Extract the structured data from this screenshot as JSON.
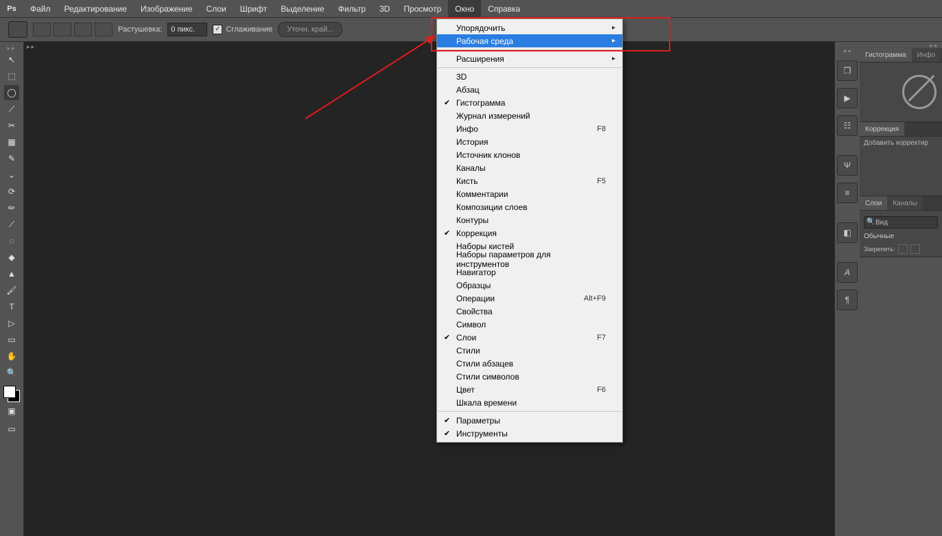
{
  "logo": "Ps",
  "menu": [
    "Файл",
    "Редактирование",
    "Изображение",
    "Слои",
    "Шрифт",
    "Выделение",
    "Фильтр",
    "3D",
    "Просмотр",
    "Окно",
    "Справка"
  ],
  "menu_active": "Окно",
  "options": {
    "feather_label": "Растушевка:",
    "feather_value": "0 пикс.",
    "antialias": "Сглаживание",
    "refine": "Уточн. край..."
  },
  "toolbar_icons": [
    "↖",
    "⬚",
    "◯",
    "⟋",
    "✂",
    "▦",
    "✎",
    "⌄",
    "⟳",
    "✏",
    "⟋",
    "◌",
    "◆",
    "▲",
    "🖌",
    "T",
    "▷",
    "▭",
    "✋",
    "🔍"
  ],
  "toolbar_selected": 2,
  "dropdown": {
    "arrange": "Упорядочить",
    "workspace": "Рабочая среда",
    "extensions": "Расширения",
    "items": [
      {
        "label": "3D"
      },
      {
        "label": "Абзац"
      },
      {
        "label": "Гистограмма",
        "checked": true
      },
      {
        "label": "Журнал измерений"
      },
      {
        "label": "Инфо",
        "short": "F8"
      },
      {
        "label": "История"
      },
      {
        "label": "Источник клонов"
      },
      {
        "label": "Каналы"
      },
      {
        "label": "Кисть",
        "short": "F5"
      },
      {
        "label": "Комментарии"
      },
      {
        "label": "Композиции слоев"
      },
      {
        "label": "Контуры"
      },
      {
        "label": "Коррекция",
        "checked": true
      },
      {
        "label": "Наборы кистей"
      },
      {
        "label": "Наборы параметров для инструментов"
      },
      {
        "label": "Навигатор"
      },
      {
        "label": "Образцы"
      },
      {
        "label": "Операции",
        "short": "Alt+F9"
      },
      {
        "label": "Свойства"
      },
      {
        "label": "Символ"
      },
      {
        "label": "Слои",
        "short": "F7",
        "checked": true
      },
      {
        "label": "Стили"
      },
      {
        "label": "Стили абзацев"
      },
      {
        "label": "Стили символов"
      },
      {
        "label": "Цвет",
        "short": "F6"
      },
      {
        "label": "Шкала времени"
      }
    ],
    "bottom": [
      {
        "label": "Параметры",
        "checked": true
      },
      {
        "label": "Инструменты",
        "checked": true
      }
    ]
  },
  "panels": {
    "histogram": {
      "tab1": "Гистограмма",
      "tab2": "Инфо"
    },
    "adjust": {
      "tab": "Коррекция",
      "body": "Добавить корректир"
    },
    "layers": {
      "tab1": "Слои",
      "tab2": "Каналы",
      "search": "Вид",
      "mode": "Обычные",
      "lock": "Закрепить:"
    }
  }
}
